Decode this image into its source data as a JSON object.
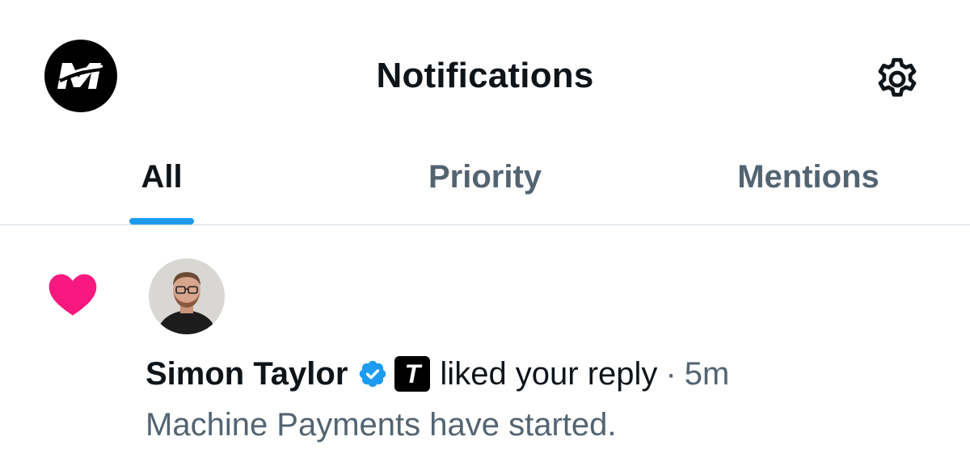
{
  "header": {
    "title": "Notifications",
    "account_logo_icon": "mt-monogram-logo",
    "settings_icon": "gear-icon"
  },
  "tabs": [
    {
      "label": "All",
      "active": true
    },
    {
      "label": "Priority",
      "active": false
    },
    {
      "label": "Mentions",
      "active": false
    }
  ],
  "notification": {
    "type_icon": "heart-icon",
    "user_name": "Simon Taylor",
    "affiliate_badge": "T",
    "action": "liked your reply",
    "separator": "·",
    "time": "5m",
    "snippet": "Machine Payments have started."
  },
  "colors": {
    "accent": "#1d9bf0",
    "like": "#f91880",
    "text_primary": "#0f1419",
    "text_secondary": "#536471",
    "divider": "#cfd9de"
  }
}
